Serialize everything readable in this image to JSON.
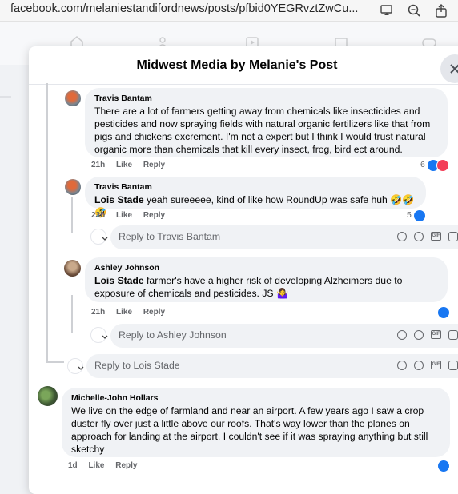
{
  "browser": {
    "url": "facebook.com/melaniestandifordnews/posts/pfbid0YEGRvztZwCu..."
  },
  "modal": {
    "title": "Midwest Media by Melanie's Post"
  },
  "comments": [
    {
      "author": "Travis Bantam",
      "mention": "",
      "text": "There are a lot of farmers getting away from chemicals like insecticides and pesticides and now spraying fields with natural organic fertilizers like that from pigs and chickens excrement. I'm not a expert but I think I would trust natural organic more than chemicals that kill every insect, frog, bird ect around.",
      "time": "21h",
      "like": "Like",
      "reply": "Reply",
      "reactions": "6"
    },
    {
      "author": "Travis Bantam",
      "mention": "Lois Stade",
      "text": " yeah sureeeee, kind of like how RoundUp was safe huh 🤣🤣🤣",
      "time": "23h",
      "like": "Like",
      "reply": "Reply",
      "reactions": "5"
    },
    {
      "author": "Ashley Johnson",
      "mention": "Lois Stade",
      "text": " farmer's have a higher risk of developing Alzheimers due to exposure of chemicals and pesticides. JS 🤷‍♀️",
      "time": "21h",
      "like": "Like",
      "reply": "Reply",
      "reactions": ""
    },
    {
      "author": "Michelle-John Hollars",
      "mention": "",
      "text": "We live on the edge of farmland and near an airport. A few years ago I saw a crop duster fly over just a little above our roofs. That's way lower than the planes on approach for landing at the airport. I couldn't see if it was spraying anything but still sketchy",
      "time": "1d",
      "like": "Like",
      "reply": "Reply",
      "reactions": ""
    }
  ],
  "reply_boxes": [
    {
      "placeholder": "Reply to Travis Bantam"
    },
    {
      "placeholder": "Reply to Ashley Johnson"
    },
    {
      "placeholder": "Reply to Lois Stade"
    }
  ],
  "icons": {
    "gif_label": "GIF"
  },
  "colors": {
    "like_blue": "#1877f2",
    "love_red": "#f33e58",
    "bubble": "#f0f2f5",
    "meta_gray": "#65676b"
  }
}
